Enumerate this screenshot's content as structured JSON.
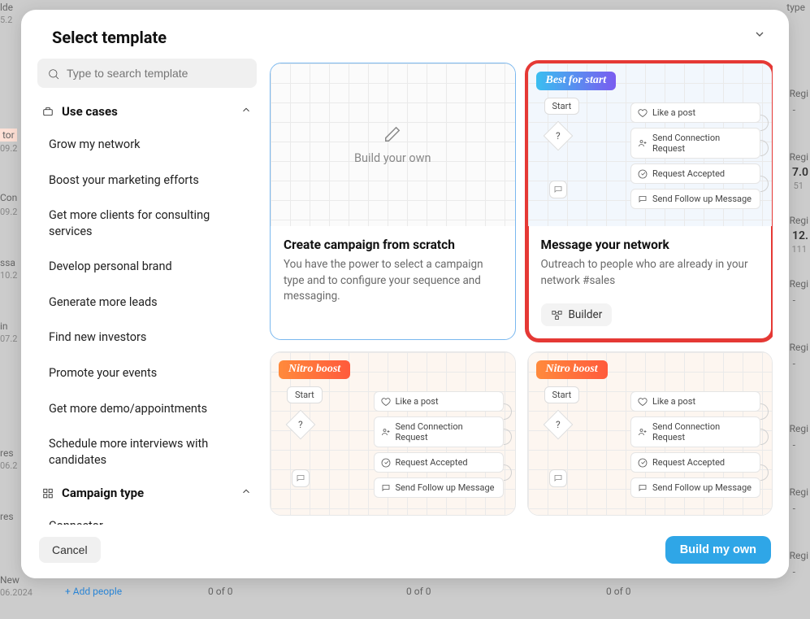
{
  "title": "Select template",
  "search": {
    "placeholder": "Type to search template"
  },
  "sections": {
    "useCases": {
      "label": "Use cases",
      "items": [
        "Grow my network",
        "Boost your marketing efforts",
        "Get more clients for consulting services",
        "Develop personal brand",
        "Generate more leads",
        "Find new investors",
        "Promote your events",
        "Get more demo/appointments",
        "Schedule more interviews with candidates"
      ]
    },
    "campaignType": {
      "label": "Campaign type",
      "items": [
        "Connector"
      ]
    }
  },
  "cards": {
    "scratch": {
      "previewLabel": "Build your own",
      "title": "Create campaign from scratch",
      "desc": "You have the power to select a campaign type and to configure your sequence and messaging."
    },
    "featured": {
      "badge": "Best for start",
      "start": "Start",
      "diamond": "?",
      "steps": [
        "Like a post",
        "Send Connection Request",
        "Request Accepted",
        "Send Follow up Message"
      ],
      "title": "Message your network",
      "desc": "Outreach to people who are already in your network #sales",
      "chip": "Builder"
    },
    "nitroA": {
      "badge": "Nitro boost",
      "start": "Start",
      "diamond": "?",
      "steps": [
        "Like a post",
        "Send Connection Request",
        "Request Accepted",
        "Send Follow up Message"
      ]
    },
    "nitroB": {
      "badge": "Nitro boost",
      "start": "Start",
      "diamond": "?",
      "steps": [
        "Like a post",
        "Send Connection Request",
        "Request Accepted",
        "Send Follow up Message"
      ]
    }
  },
  "footer": {
    "cancel": "Cancel",
    "primary": "Build my own"
  },
  "bg": {
    "addPeople": "Add people",
    "zeroOfZero": "0 of 0",
    "regi": "Regi",
    "seven": "7.0",
    "fiftyone": "51",
    "twelve": "12.",
    "oneeleven": "111",
    "type": "type",
    "dash": "-",
    "ssa": "ssa",
    "in": "in",
    "res": "res",
    "new": "New",
    "lde": "lde",
    "con": "Con",
    "tor": "tor",
    "date1": "5.2",
    "date2": "09.2",
    "date3": "09.2",
    "date4": "10.2",
    "date5": "07.2",
    "date6": "06.2",
    "date7": "06.2024"
  }
}
